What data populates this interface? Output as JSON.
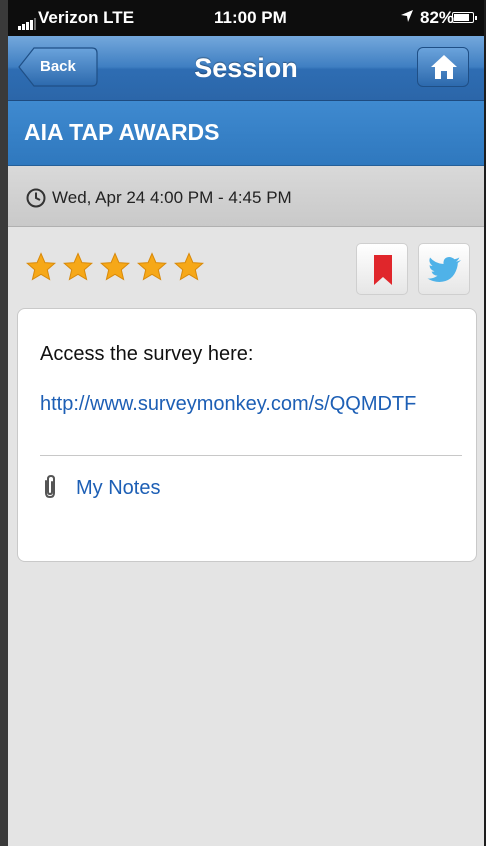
{
  "status_bar": {
    "carrier": "Verizon  LTE",
    "time": "11:00 PM",
    "battery": "82%"
  },
  "nav": {
    "back_label": "Back",
    "title": "Session",
    "home_icon": "home-icon"
  },
  "session": {
    "title": "AIA TAP AWARDS",
    "time": "Wed, Apr 24 4:00 PM - 4:45 PM",
    "rating": 5,
    "rating_max": 5
  },
  "actions": {
    "bookmark_icon": "bookmark-icon",
    "twitter_icon": "twitter-icon"
  },
  "content": {
    "survey_label": "Access the survey here:",
    "survey_link": "http://www.surveymonkey.com/s/QQMDTF",
    "notes_label": "My Notes"
  },
  "colors": {
    "nav_blue": "#3f7fc2",
    "title_blue": "#2f78be",
    "link_blue": "#1d5fb5",
    "star_gold": "#f6a818",
    "bookmark_red": "#e0262b",
    "twitter_blue": "#4fb2e8"
  }
}
